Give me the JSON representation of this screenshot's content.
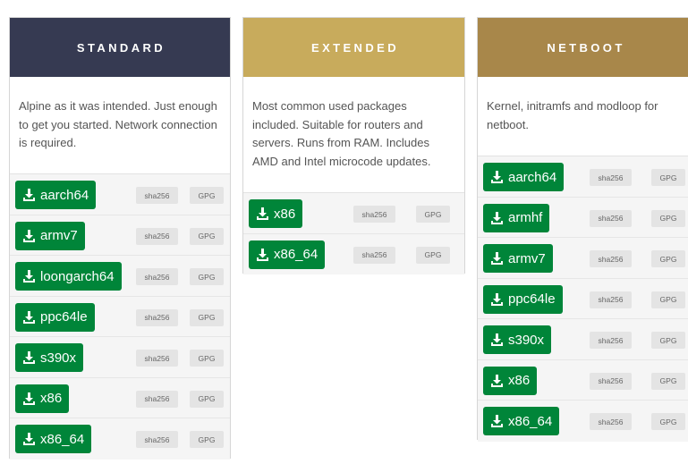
{
  "columns": {
    "standard": {
      "title": "STANDARD",
      "description": "Alpine as it was intended. Just enough to get you started. Network connection is required.",
      "items": [
        "aarch64",
        "armv7",
        "loongarch64",
        "ppc64le",
        "s390x",
        "x86",
        "x86_64"
      ]
    },
    "extended": {
      "title": "EXTENDED",
      "description": "Most common used packages included. Suitable for routers and servers. Runs from RAM. Includes AMD and Intel microcode updates.",
      "items": [
        "x86",
        "x86_64"
      ]
    },
    "netboot": {
      "title": "NETBOOT",
      "description": "Kernel, initramfs and modloop for netboot.",
      "items": [
        "aarch64",
        "armhf",
        "armv7",
        "ppc64le",
        "s390x",
        "x86",
        "x86_64"
      ]
    }
  },
  "labels": {
    "checksum": "sha256",
    "signature": "GPG"
  },
  "colors": {
    "standard_header": "#363a52",
    "extended_header": "#c8ab5c",
    "netboot_header": "#a8874a",
    "download_button": "#008539"
  },
  "icons": {
    "download": "download-icon"
  }
}
